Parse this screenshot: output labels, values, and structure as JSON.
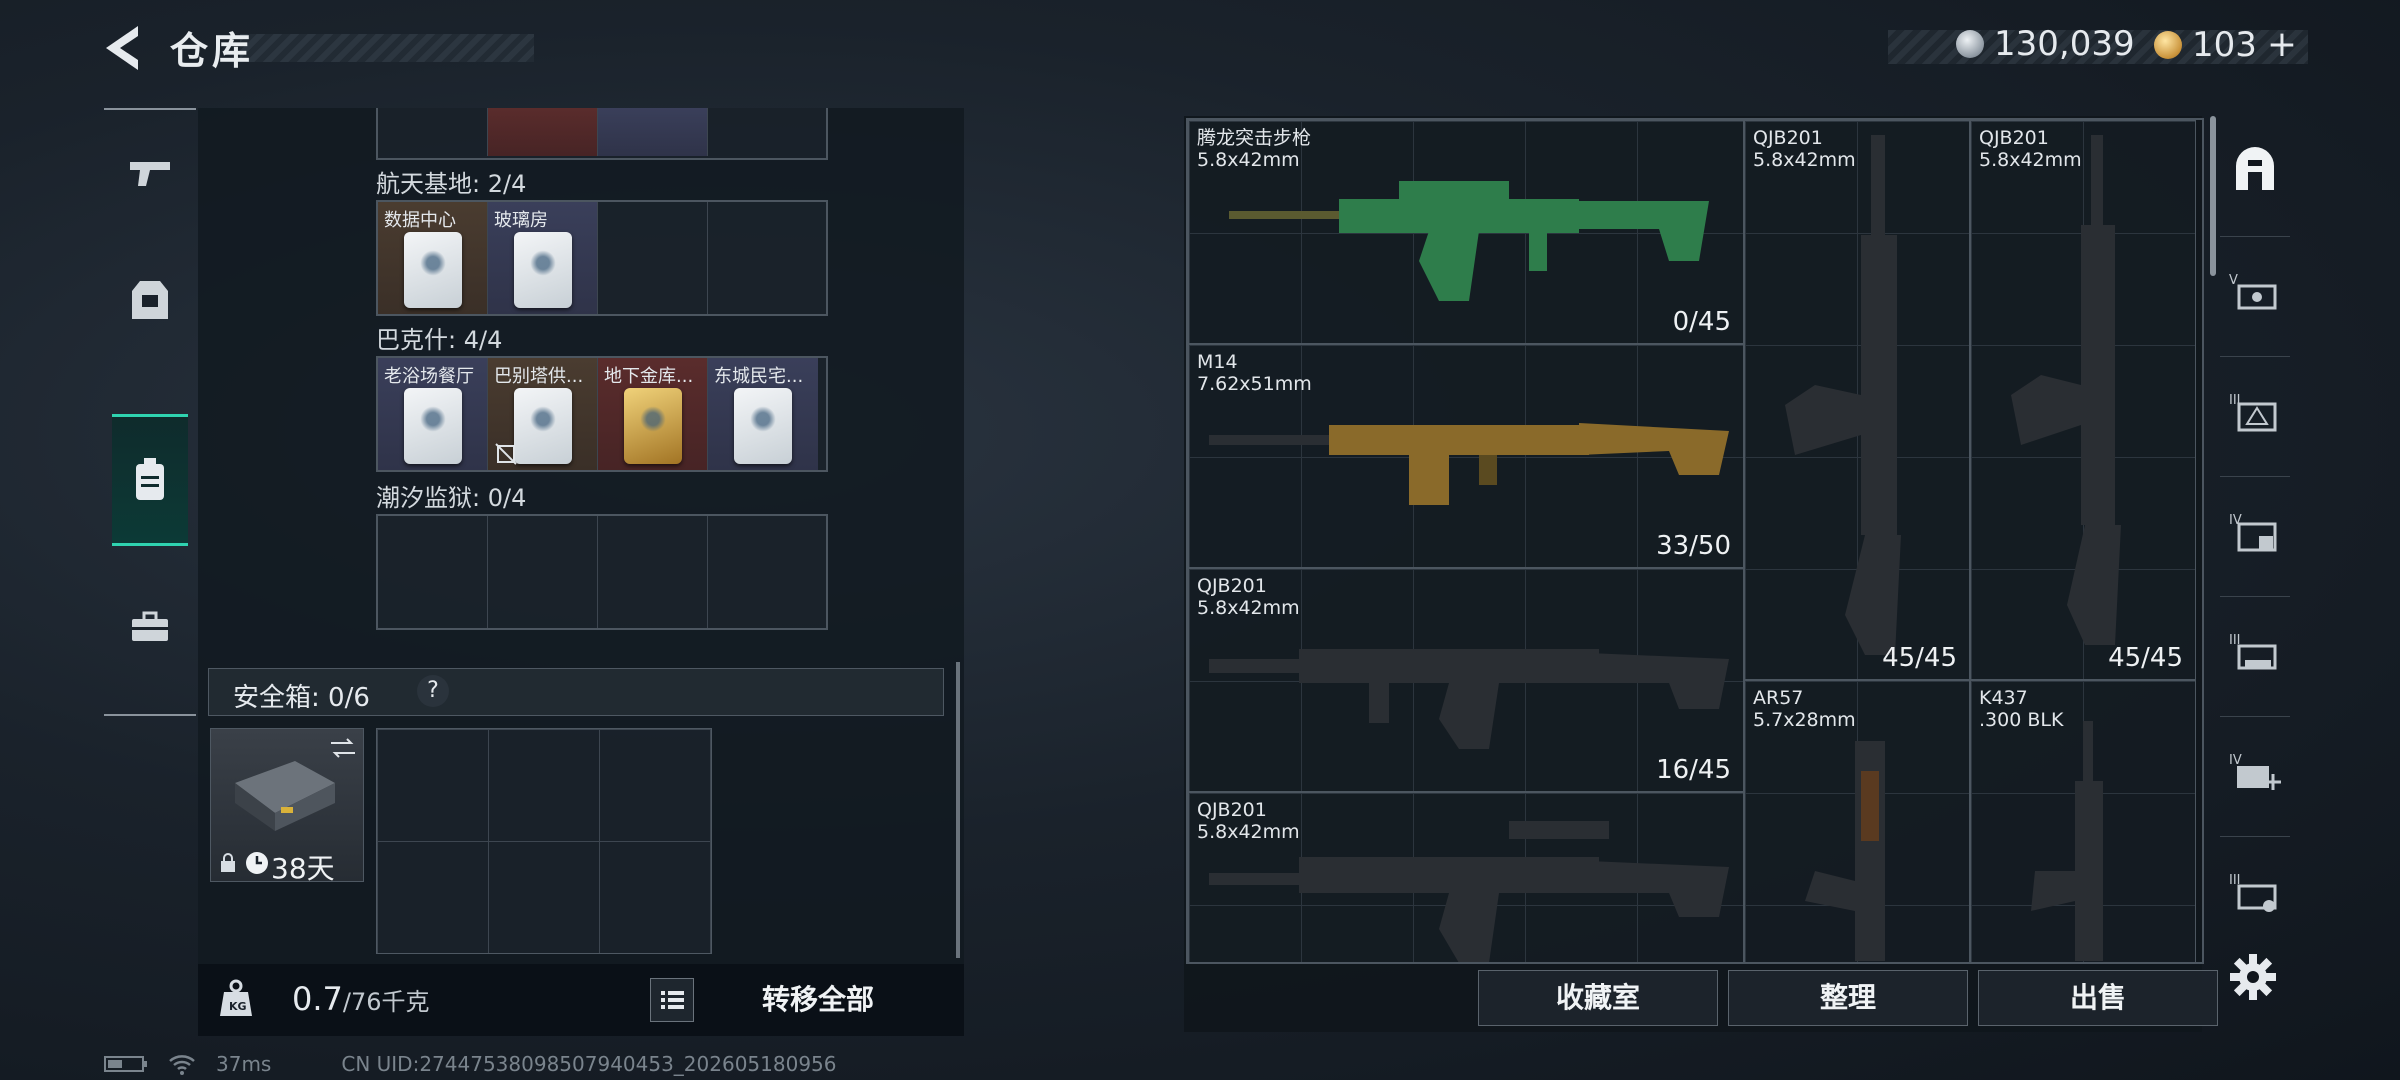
{
  "header": {
    "title": "仓库",
    "currency_silver": "130,039",
    "currency_gold": "103",
    "plus": "+"
  },
  "storage": {
    "sections": [
      {
        "label": "航天基地: 2/4",
        "cards": [
          {
            "label": "数据中心",
            "style": "brown",
            "has_card": true
          },
          {
            "label": "玻璃房",
            "style": "blue",
            "has_card": true
          },
          {
            "label": "",
            "style": "empty",
            "has_card": false
          },
          {
            "label": "",
            "style": "empty",
            "has_card": false
          }
        ]
      },
      {
        "label": "巴克什: 4/4",
        "cards": [
          {
            "label": "老浴场餐厅",
            "style": "blue",
            "has_card": true
          },
          {
            "label": "巴别塔供...",
            "style": "brown",
            "has_card": true
          },
          {
            "label": "地下金库...",
            "style": "red",
            "has_card": true,
            "gold": true
          },
          {
            "label": "东城民宅...",
            "style": "blue",
            "has_card": true
          }
        ]
      },
      {
        "label": "潮汐监狱: 0/4",
        "cards": [
          {
            "label": "",
            "style": "empty",
            "has_card": false
          },
          {
            "label": "",
            "style": "empty",
            "has_card": false
          },
          {
            "label": "",
            "style": "empty",
            "has_card": false
          },
          {
            "label": "",
            "style": "empty",
            "has_card": false
          }
        ]
      }
    ],
    "safe_box_label": "安全箱: 0/6",
    "safe_box_help": "?",
    "safe_box_days": "38天",
    "weight_current": "0.7",
    "weight_max": "/76千克",
    "transfer_all": "转移全部"
  },
  "weapons": [
    {
      "name": "腾龙突击步枪",
      "caliber": "5.8x42mm",
      "ammo": "0/45",
      "color": "#2e7d4b"
    },
    {
      "name": "M14",
      "caliber": "7.62x51mm",
      "ammo": "33/50",
      "color": "#8a6a2a"
    },
    {
      "name": "QJB201",
      "caliber": "5.8x42mm",
      "ammo": "16/45",
      "color": "#2a2e33"
    },
    {
      "name": "QJB201",
      "caliber": "5.8x42mm",
      "ammo": "",
      "color": "#2a2e33"
    },
    {
      "name": "QJB201",
      "caliber": "5.8x42mm",
      "ammo": "45/45",
      "color": "#2a2e33"
    },
    {
      "name": "QJB201",
      "caliber": "5.8x42mm",
      "ammo": "45/45",
      "color": "#2a2e33"
    },
    {
      "name": "AR57",
      "caliber": "5.7x28mm",
      "ammo": "",
      "color": "#2a2e33"
    },
    {
      "name": "K437",
      "caliber": ".300 BLK",
      "ammo": "",
      "color": "#2a2e33"
    }
  ],
  "actions": {
    "collection": "收藏室",
    "organize": "整理",
    "sell": "出售"
  },
  "filters": [
    "all-icon",
    "tier-v-icon",
    "tier-iii-icon",
    "tier-iv-icon",
    "tier-iii-b-icon",
    "tier-iv-plus-icon",
    "tier-iii-c-icon"
  ],
  "status": {
    "ping": "37ms",
    "uid": "CN UID:27447538098507940453_202605180956"
  }
}
